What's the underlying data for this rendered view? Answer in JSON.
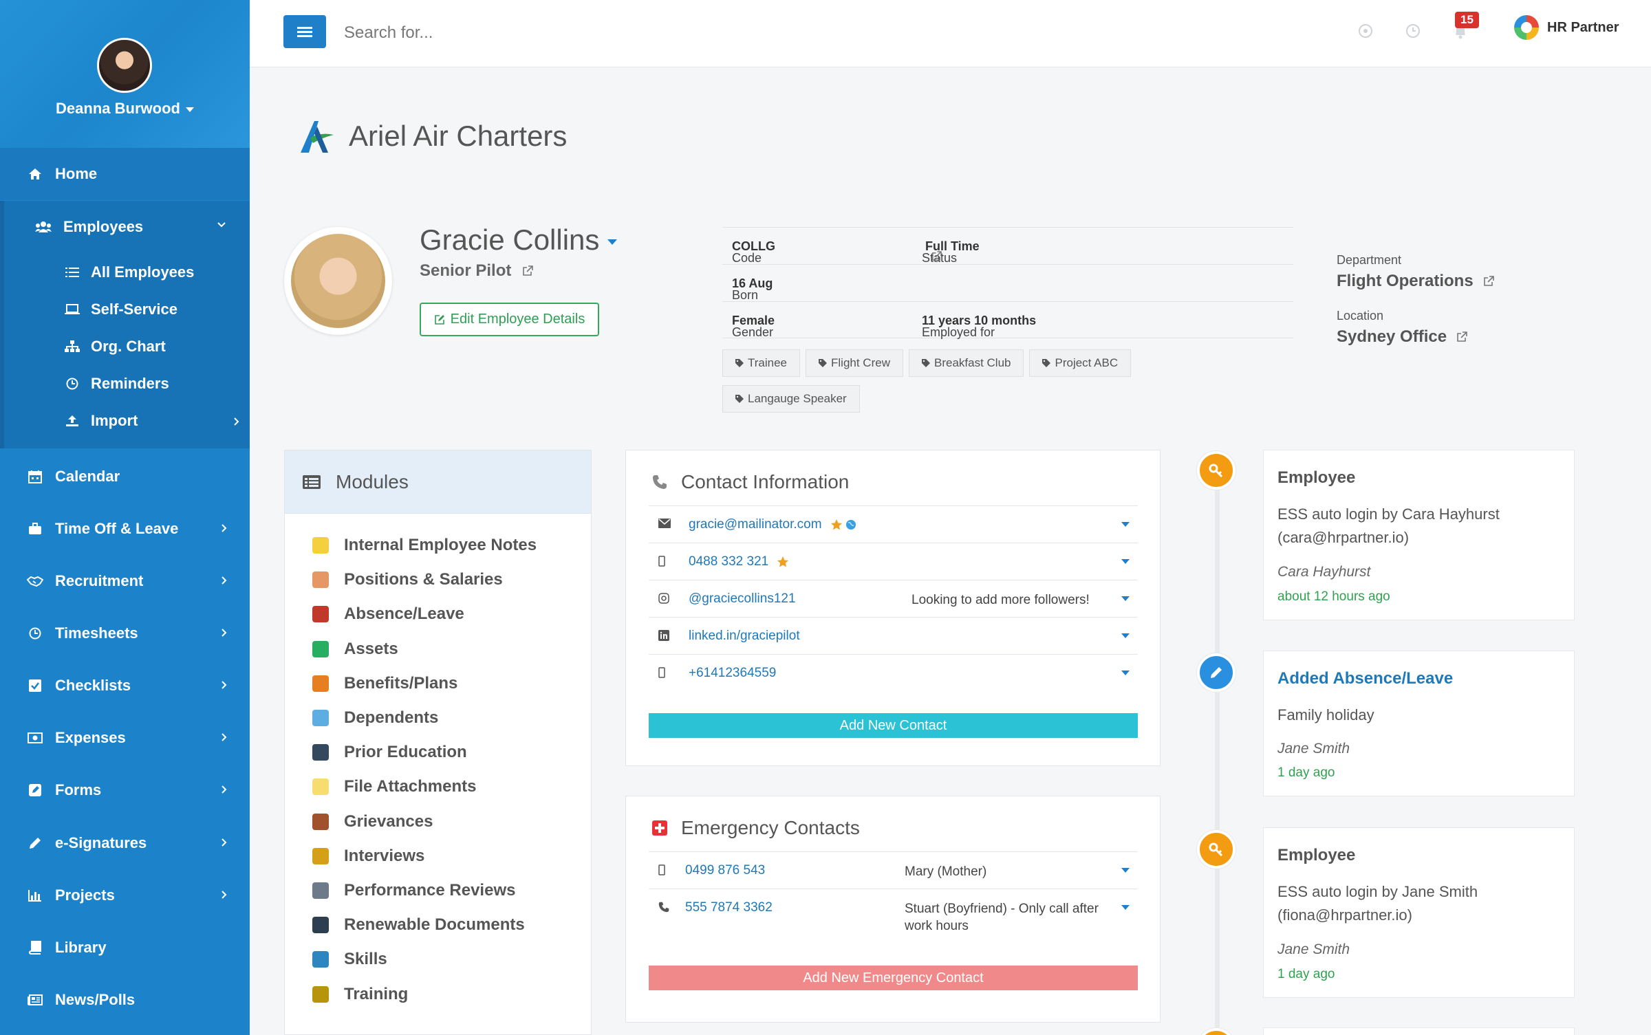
{
  "sidebar": {
    "user_name": "Deanna Burwood",
    "items": {
      "home": "Home",
      "employees": "Employees",
      "calendar": "Calendar",
      "time_off": "Time Off & Leave",
      "recruitment": "Recruitment",
      "timesheets": "Timesheets",
      "checklists": "Checklists",
      "expenses": "Expenses",
      "forms": "Forms",
      "esignatures": "e-Signatures",
      "projects": "Projects",
      "library": "Library",
      "news": "News/Polls"
    },
    "employee_sub": {
      "all": "All Employees",
      "self_service": "Self-Service",
      "org_chart": "Org. Chart",
      "reminders": "Reminders",
      "import": "Import"
    }
  },
  "topbar": {
    "search_placeholder": "Search for...",
    "notification_count": "15",
    "brand": "HR Partner"
  },
  "company": {
    "name": "Ariel Air Charters"
  },
  "employee": {
    "name": "Gracie Collins",
    "title": "Senior Pilot",
    "edit_label": "Edit Employee Details",
    "code_label": "Code",
    "code": "COLLG",
    "status_label": "Status",
    "status": "Full Time",
    "born_label": "Born",
    "born": "16 Aug",
    "gender_label": "Gender",
    "gender": "Female",
    "employed_label": "Employed for",
    "employed": "11 years 10 months",
    "tags": [
      "Trainee",
      "Flight Crew",
      "Breakfast Club",
      "Project ABC",
      "Langauge Speaker"
    ],
    "department_label": "Department",
    "department": "Flight Operations",
    "location_label": "Location",
    "location": "Sydney Office"
  },
  "modules": {
    "title": "Modules",
    "items": [
      "Internal Employee Notes",
      "Positions & Salaries",
      "Absence/Leave",
      "Assets",
      "Benefits/Plans",
      "Dependents",
      "Prior Education",
      "File Attachments",
      "Grievances",
      "Interviews",
      "Performance Reviews",
      "Renewable Documents",
      "Skills",
      "Training"
    ],
    "colors": [
      "#f4d03f",
      "#e59866",
      "#c0392b",
      "#27ae60",
      "#e67e22",
      "#5dade2",
      "#34495e",
      "#f7dc6f",
      "#a0522d",
      "#d4a017",
      "#6c7a89",
      "#2c3e50",
      "#2e86c1",
      "#b7950b"
    ]
  },
  "contact": {
    "title": "Contact Information",
    "rows": [
      {
        "value": "gracie@mailinator.com",
        "note": ""
      },
      {
        "value": "0488 332 321",
        "note": ""
      },
      {
        "value": "@graciecollins121",
        "note": "Looking to add more followers!"
      },
      {
        "value": "linked.in/graciepilot",
        "note": ""
      },
      {
        "value": "+61412364559",
        "note": ""
      }
    ],
    "add_label": "Add New Contact"
  },
  "emergency": {
    "title": "Emergency Contacts",
    "rows": [
      {
        "value": "0499 876 543",
        "note": "Mary (Mother)"
      },
      {
        "value": "555 7874 3362",
        "note": "Stuart (Boyfriend) - Only call after work hours"
      }
    ],
    "add_label": "Add New Emergency Contact"
  },
  "timeline": [
    {
      "title": "Employee",
      "body": "ESS auto login by Cara Hayhurst (cara@hrpartner.io)",
      "who": "Cara Hayhurst",
      "time": "about 12 hours ago"
    },
    {
      "title": "Added Absence/Leave",
      "body": "Family holiday",
      "who": "Jane Smith",
      "time": "1 day ago"
    },
    {
      "title": "Employee",
      "body": "ESS auto login by Jane Smith (fiona@hrpartner.io)",
      "who": "Jane Smith",
      "time": "1 day ago"
    }
  ],
  "colors": {
    "sidebar": "#1c82c9",
    "primary": "#1f7fc9",
    "success": "#36a85c",
    "cyan": "#2bc2d6",
    "danger": "#f08a8a",
    "orange": "#f39c12",
    "blue_dot": "#2b8fe0"
  }
}
